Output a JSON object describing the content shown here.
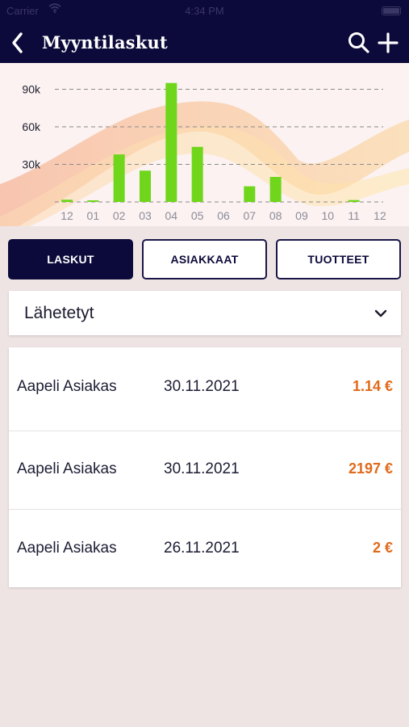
{
  "status_bar": {
    "carrier": "Carrier",
    "time": "4:34 PM"
  },
  "header": {
    "title": "Myyntilaskut"
  },
  "tabs": [
    {
      "label": "LASKUT",
      "active": true
    },
    {
      "label": "ASIAKKAAT",
      "active": false
    },
    {
      "label": "TUOTTEET",
      "active": false
    }
  ],
  "filter": {
    "selected": "Lähetetyt"
  },
  "invoices": [
    {
      "customer": "Aapeli Asiakas",
      "date": "30.11.2021",
      "amount": "1.14 €"
    },
    {
      "customer": "Aapeli Asiakas",
      "date": "30.11.2021",
      "amount": "2197 €"
    },
    {
      "customer": "Aapeli Asiakas",
      "date": "26.11.2021",
      "amount": "2 €"
    }
  ],
  "colors": {
    "header_bg": "#0c0a3a",
    "bar": "#6fd61b",
    "amount": "#e06a1b",
    "page_bg": "#efe4e4"
  },
  "icons": [
    "back-chevron-icon",
    "search-icon",
    "plus-icon",
    "chevron-down-icon"
  ],
  "chart_data": {
    "type": "bar",
    "categories": [
      "12",
      "01",
      "02",
      "03",
      "04",
      "05",
      "06",
      "07",
      "08",
      "09",
      "10",
      "11",
      "12"
    ],
    "values": [
      1800,
      1000,
      38000,
      25000,
      95000,
      44000,
      0,
      12500,
      20000,
      0,
      0,
      1500,
      0
    ],
    "yticks": [
      "90k",
      "60k",
      "30k"
    ],
    "ytick_values": [
      90000,
      60000,
      30000
    ],
    "ylim": [
      0,
      100000
    ],
    "grid": true,
    "title": "",
    "xlabel": "",
    "ylabel": ""
  }
}
